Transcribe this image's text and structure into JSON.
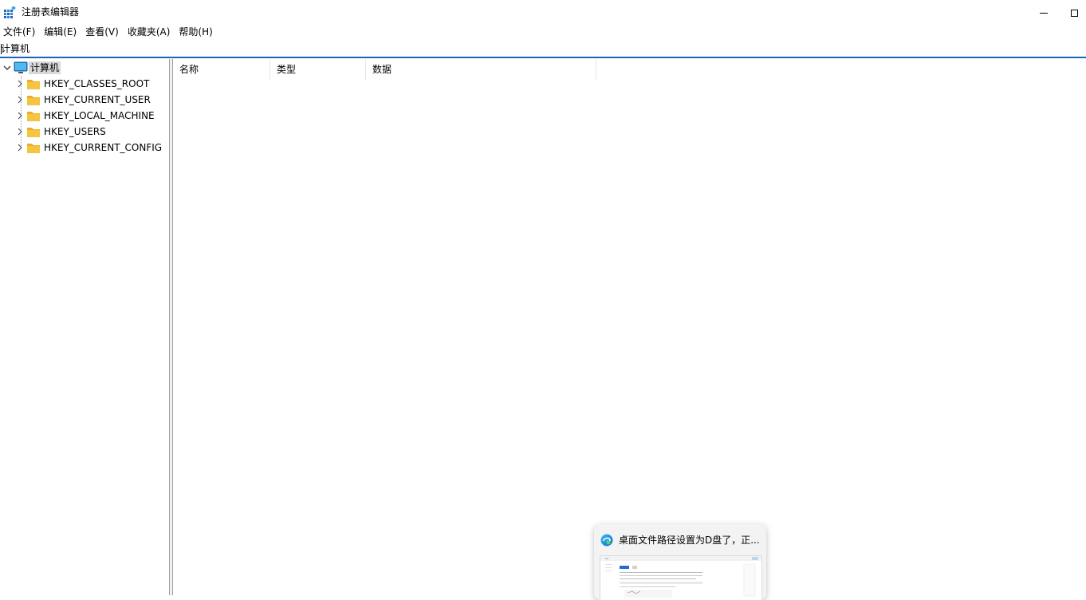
{
  "window": {
    "title": "注册表编辑器",
    "icon": "regedit-icon"
  },
  "menu": {
    "items": [
      "文件(F)",
      "编辑(E)",
      "查看(V)",
      "收藏夹(A)",
      "帮助(H)"
    ]
  },
  "address": {
    "value": "计算机"
  },
  "tree": {
    "root": "计算机",
    "children": [
      "HKEY_CLASSES_ROOT",
      "HKEY_CURRENT_USER",
      "HKEY_LOCAL_MACHINE",
      "HKEY_USERS",
      "HKEY_CURRENT_CONFIG"
    ]
  },
  "list": {
    "columns": [
      "名称",
      "类型",
      "数据"
    ]
  },
  "toast": {
    "title": "桌面文件路径设置为D盘了，正...",
    "icon": "edge-icon"
  },
  "colors": {
    "accent": "#1c64b4",
    "folder": "#f5c542",
    "selection": "#d9d9d9"
  }
}
